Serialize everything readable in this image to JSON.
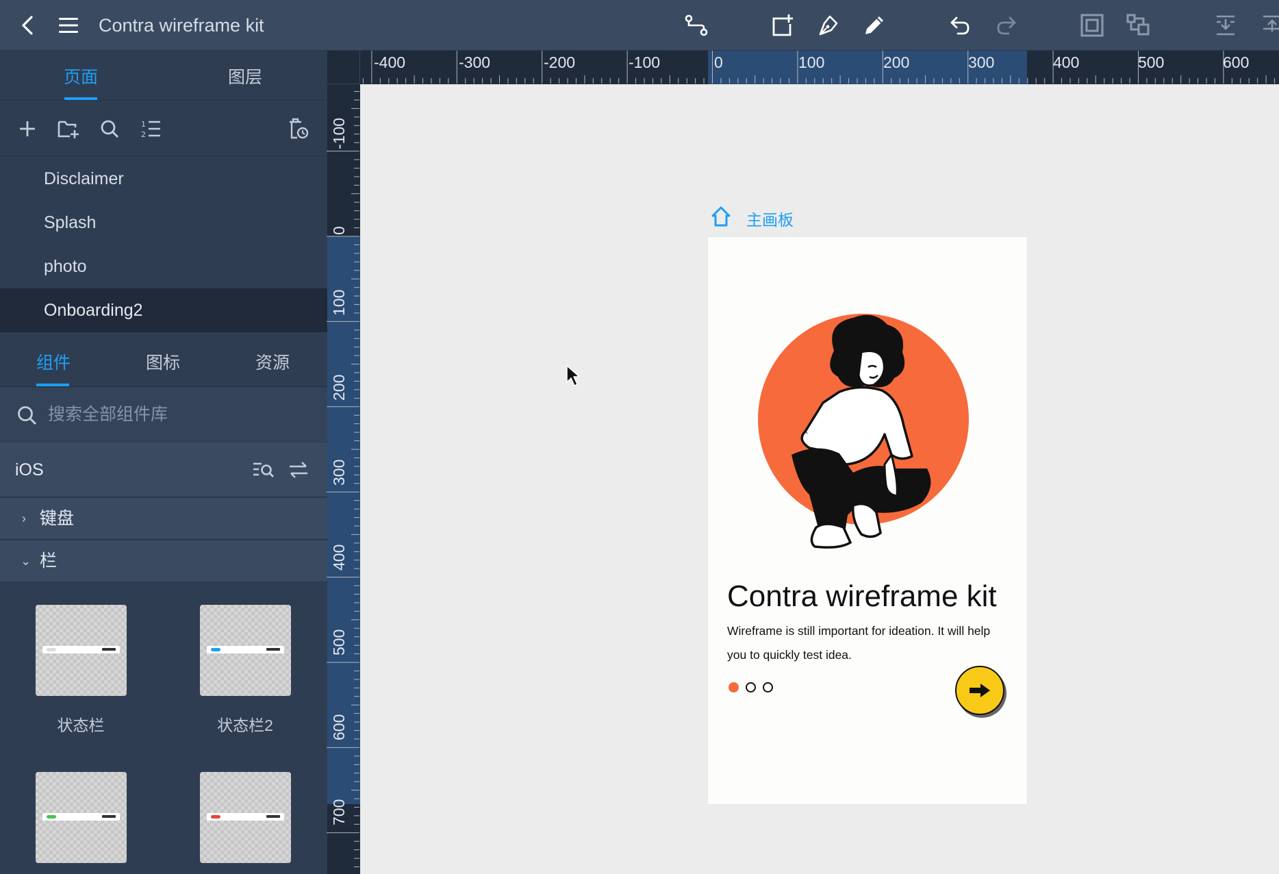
{
  "toolbar": {
    "title": "Contra wireframe kit",
    "icons": [
      "back-icon",
      "menu-icon",
      "connector-icon",
      "add-frame-icon",
      "pen-icon",
      "pencil-icon",
      "undo-icon",
      "redo-icon",
      "group-frame-icon",
      "ungroup-icon",
      "align-bottom-icon",
      "align-top-icon"
    ]
  },
  "left_panel": {
    "tabs": [
      "页面",
      "图层"
    ],
    "active_tab": "页面",
    "pages": [
      "Disclaimer",
      "Splash",
      "photo",
      "Onboarding2"
    ],
    "active_page": "Onboarding2",
    "lib_tabs": [
      "组件",
      "图标",
      "资源"
    ],
    "active_lib_tab": "组件",
    "search": {
      "placeholder": "搜索全部组件库"
    },
    "library": "iOS",
    "categories": [
      {
        "label": "键盘",
        "expanded": false
      },
      {
        "label": "栏",
        "expanded": true
      }
    ],
    "components": [
      {
        "label": "状态栏",
        "pill_color": "#ffffff"
      },
      {
        "label": "状态栏2",
        "pill_color": "#1e9ff2"
      },
      {
        "label": "",
        "pill_color": "#4cbf55"
      },
      {
        "label": "",
        "pill_color": "#e5463b"
      }
    ]
  },
  "rulers": {
    "horizontal": [
      "-400",
      "-300",
      "-200",
      "-100",
      "0",
      "100",
      "200",
      "300",
      "400",
      "500",
      "600"
    ],
    "vertical": [
      "-100",
      "0",
      "100",
      "200",
      "300",
      "400",
      "500",
      "600",
      "700"
    ]
  },
  "canvas": {
    "board_name": "主画板",
    "artboard": {
      "title": "Contra wireframe kit",
      "description": "Wireframe is still important for ideation. It will help you to quickly test idea.",
      "pager": {
        "count": 3,
        "active": 0
      },
      "accent": "#f76a3b",
      "button_color": "#f9c918"
    }
  },
  "colors": {
    "accent": "#1e9ff2",
    "toolbar_bg": "#3a4a61",
    "panel_bg": "#2f3d52"
  }
}
